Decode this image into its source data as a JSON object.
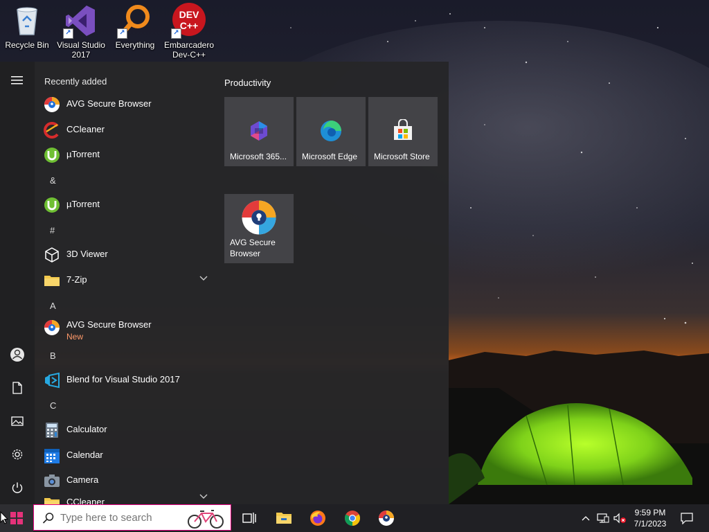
{
  "desktop": {
    "icons": [
      {
        "label": "Recycle Bin"
      },
      {
        "label": "Visual Studio 2017"
      },
      {
        "label": "Everything"
      },
      {
        "label": "Embarcadero Dev-C++"
      }
    ],
    "devcpp_logo_text": "DEV C++"
  },
  "start_menu": {
    "rail": {
      "items": [
        "hamburger-icon",
        "user-icon",
        "documents-icon",
        "pictures-icon",
        "settings-icon",
        "power-icon"
      ]
    },
    "app_list": {
      "recently_added_header": "Recently added",
      "items": [
        {
          "name": "AVG Secure Browser",
          "icon": "avg-browser-icon"
        },
        {
          "name": "CCleaner",
          "icon": "ccleaner-icon"
        },
        {
          "name": "µTorrent",
          "icon": "utorrent-icon"
        },
        {
          "letter": "&"
        },
        {
          "name": "µTorrent",
          "icon": "utorrent-icon"
        },
        {
          "letter": "#"
        },
        {
          "name": "3D Viewer",
          "icon": "cube-icon"
        },
        {
          "name": "7-Zip",
          "icon": "folder-icon",
          "expandable": true
        },
        {
          "letter": "A"
        },
        {
          "name": "AVG Secure Browser",
          "sub": "New",
          "icon": "avg-browser-icon"
        },
        {
          "letter": "B"
        },
        {
          "name": "Blend for Visual Studio 2017",
          "icon": "blend-icon"
        },
        {
          "letter": "C"
        },
        {
          "name": "Calculator",
          "icon": "calculator-icon"
        },
        {
          "name": "Calendar",
          "icon": "calendar-icon"
        },
        {
          "name": "Camera",
          "icon": "camera-icon"
        },
        {
          "name": "CCleaner",
          "icon": "folder-icon",
          "expandable": true
        }
      ]
    },
    "tiles": {
      "group_title": "Productivity",
      "items": [
        {
          "label": "Microsoft 365...",
          "icon": "microsoft-365-icon"
        },
        {
          "label": "Microsoft Edge",
          "icon": "edge-icon"
        },
        {
          "label": "Microsoft Store",
          "icon": "store-icon"
        },
        {
          "label": "AVG Secure Browser",
          "icon": "avg-browser-icon"
        }
      ]
    }
  },
  "taskbar": {
    "search_placeholder": "Type here to search",
    "pinned": [
      "task-view-icon",
      "file-explorer-icon",
      "firefox-icon",
      "chrome-icon",
      "avg-browser-icon"
    ],
    "clock": {
      "time": "9:59 PM",
      "date": "7/1/2023"
    }
  },
  "colors": {
    "start_bg": "#262628",
    "tile_bg": "#4e4e52",
    "taskbar_bg": "#202024",
    "search_border": "#e6007e",
    "windows_logo": "#e6327a"
  }
}
